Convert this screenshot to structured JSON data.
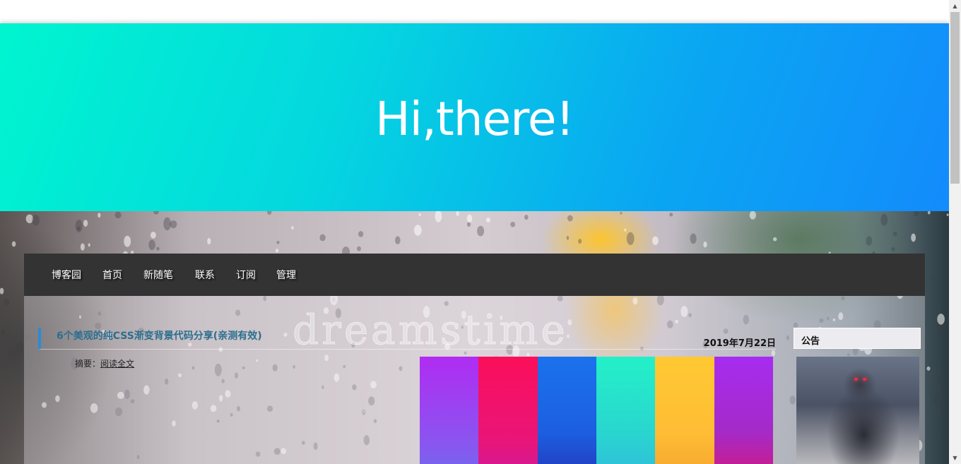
{
  "hero": {
    "title": "Hi,there!"
  },
  "nav": {
    "items": [
      "博客园",
      "首页",
      "新随笔",
      "联系",
      "订阅",
      "管理"
    ]
  },
  "post": {
    "title": "6个美观的纯CSS渐变背景代码分享(亲测有效)",
    "date": "2019年7月22日",
    "summary_label": "摘要：",
    "read_more": "阅读全文"
  },
  "sidebar": {
    "title": "公告"
  },
  "colors": {
    "stripes": [
      "#a93ff0",
      "#f0156a",
      "#1f6ae6",
      "#28e2c4",
      "#ffc035",
      "#a52ae8"
    ],
    "accent": "#2a8bd6",
    "nav_bg": "#333333"
  },
  "background_image": "rain-on-glass",
  "watermark": "dreamstime"
}
